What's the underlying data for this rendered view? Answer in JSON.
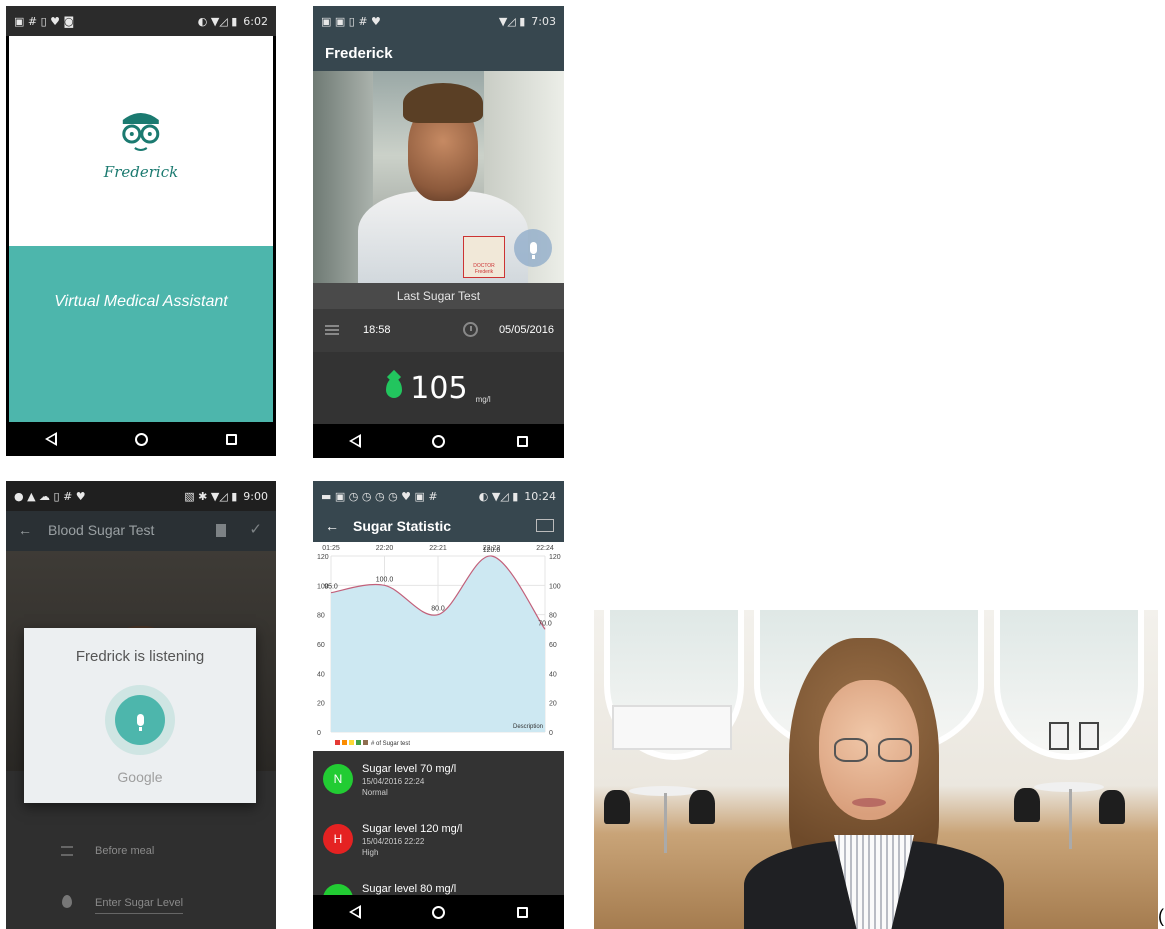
{
  "phone1": {
    "status_time": "6:02",
    "brand": "Frederick",
    "tagline": "Virtual Medical Assistant"
  },
  "phone2": {
    "status_time": "7:03",
    "app_title": "Frederick",
    "badge_text": "DOCTOR\nFrederik",
    "section_title": "Last Sugar Test",
    "time": "18:58",
    "date": "05/05/2016",
    "value": "105",
    "unit": "mg/l"
  },
  "phone3": {
    "status_time": "9:00",
    "app_title": "Blood Sugar Test",
    "dialog_title": "Fredrick is listening",
    "dialog_provider": "Google",
    "field_meal": "Before meal",
    "field_level_placeholder": "Enter Sugar Level"
  },
  "phone4": {
    "status_time": "10:24",
    "app_title": "Sugar Statistic",
    "items": [
      {
        "letter": "N",
        "color": "#22cc33",
        "title": "Sugar level 70 mg/l",
        "date": "15/04/2016 22:24",
        "status": "Normal"
      },
      {
        "letter": "H",
        "color": "#e52222",
        "title": "Sugar level 120 mg/l",
        "date": "15/04/2016 22:22",
        "status": "High"
      },
      {
        "letter": "",
        "color": "#22cc33",
        "title": "Sugar level 80 mg/l",
        "date": "",
        "status": ""
      }
    ]
  },
  "chart_data": {
    "type": "area",
    "x": [
      "01:25",
      "22:20",
      "22:21",
      "22:22",
      "22:24"
    ],
    "values": [
      95.0,
      100.0,
      80.0,
      120.0,
      70.0
    ],
    "ylim": [
      0,
      120
    ],
    "yticks": [
      0,
      20,
      40,
      60,
      80,
      100,
      120
    ],
    "legend": "# of Sugar test",
    "description_label": "Description",
    "fill_color": "#cde8f2",
    "line_color": "#c2607a"
  },
  "trailing_char": "("
}
